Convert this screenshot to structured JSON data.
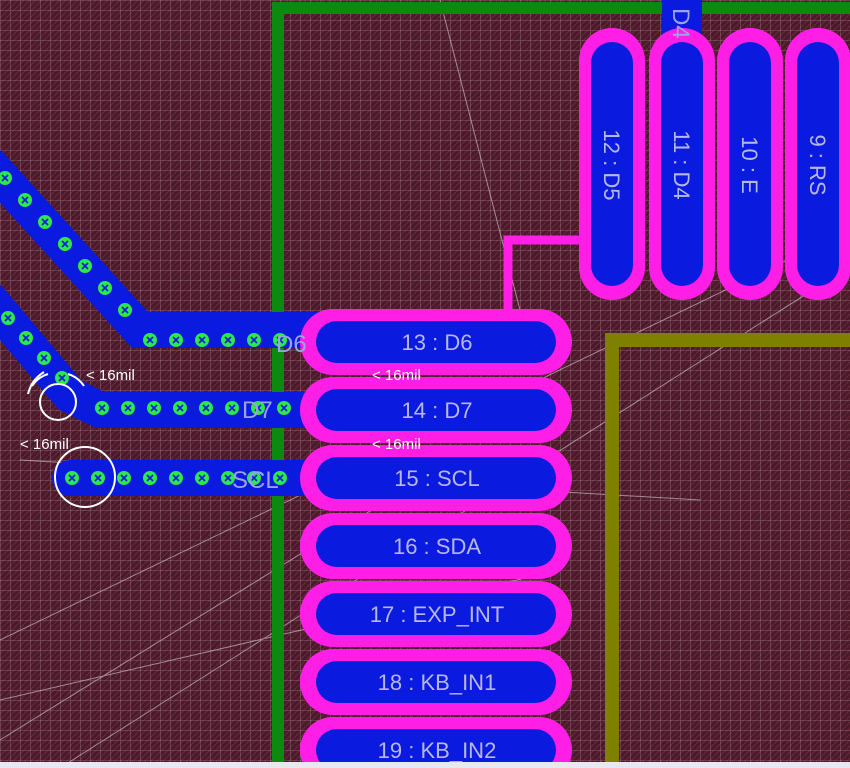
{
  "app": {
    "view": "PCB layout editor"
  },
  "colors": {
    "board": "#4a1a2a",
    "grid": "#9a7a86",
    "copper_top": "#0a1adf",
    "pad_outline": "#ff1ee6",
    "board_outline": "#0c8a10",
    "keepout": "#7f7f00",
    "via": "#2ee84a",
    "drc_marker": "#ffffff"
  },
  "pads_horizontal": [
    {
      "label": "13 : D6"
    },
    {
      "label": "14 : D7"
    },
    {
      "label": "15 : SCL"
    },
    {
      "label": "16 : SDA"
    },
    {
      "label": "17 : EXP_INT"
    },
    {
      "label": "18 : KB_IN1"
    },
    {
      "label": "19 : KB_IN2"
    }
  ],
  "pads_vertical": [
    {
      "label": "12 : D5"
    },
    {
      "label": "11 : D4"
    },
    {
      "label": "10 : E"
    },
    {
      "label": "9 : RS"
    }
  ],
  "net_labels": {
    "d6": "D6",
    "d7": "D7",
    "scl": "SCL",
    "d4": "D4"
  },
  "drc": {
    "clearance_1": "< 16mil",
    "clearance_2": "< 16mil",
    "clearance_3": "< 16mil",
    "clearance_4": "< 16mil"
  }
}
